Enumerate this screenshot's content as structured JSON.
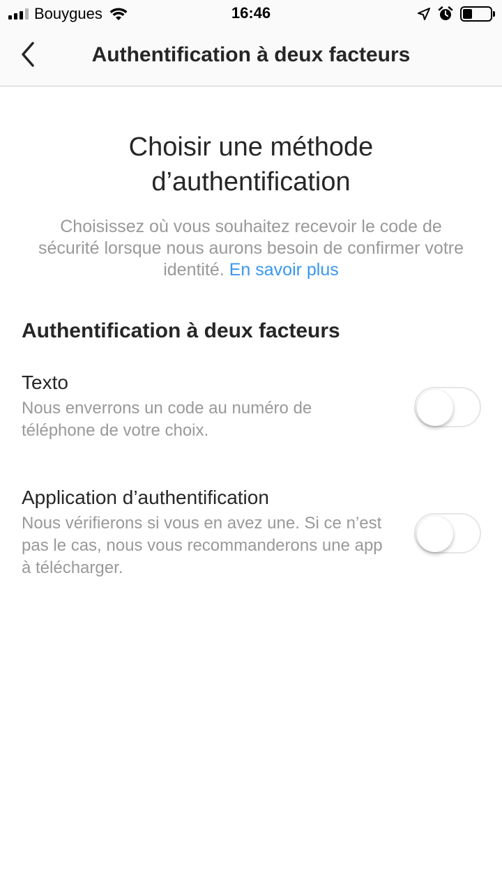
{
  "status_bar": {
    "carrier": "Bouygues",
    "time": "16:46",
    "signal_bars_filled": 3,
    "signal_bars_total": 4,
    "battery_level": 0.35
  },
  "nav": {
    "title": "Authentification à deux facteurs",
    "back_icon": "chevron-left-icon"
  },
  "main": {
    "heading": "Choisir une méthode d’authentification",
    "description": "Choisissez où vous souhaitez recevoir le code de sécurité lorsque nous aurons besoin de confirmer votre identité.",
    "learn_more": "En savoir plus",
    "section_title": "Authentification à deux facteurs",
    "options": [
      {
        "label": "Texto",
        "description": "Nous enverrons un code au numéro de téléphone de votre choix.",
        "enabled": false
      },
      {
        "label": "Application d’authentification",
        "description": "Nous vérifierons si vous en avez une. Si ce n’est pas le cas, nous vous recommanderons une app à télécharger.",
        "enabled": false
      }
    ]
  },
  "colors": {
    "link": "#3897f0",
    "primary_text": "#262626",
    "secondary_text": "#999999",
    "toggle_border": "#e5e5e5"
  }
}
